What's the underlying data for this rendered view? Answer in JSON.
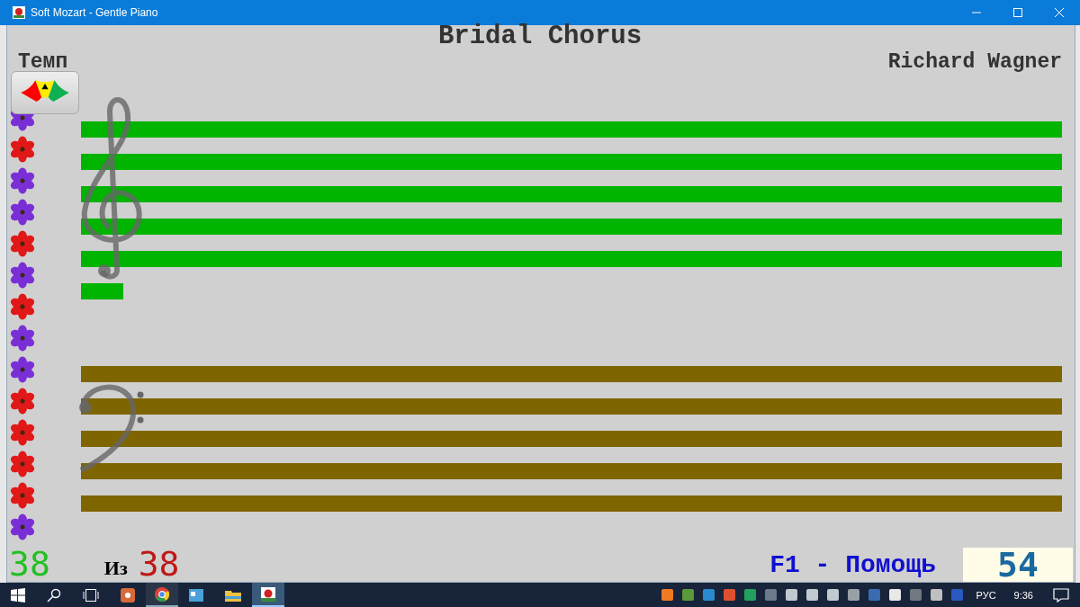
{
  "window": {
    "title": "Soft Mozart - Gentle Piano"
  },
  "piece": {
    "title": "Bridal Chorus",
    "composer": "Richard Wagner"
  },
  "tempo": {
    "label": "Темп",
    "level": 0.5
  },
  "flowers": [
    {
      "color": "#7a2fd6"
    },
    {
      "color": "#e01818"
    },
    {
      "color": "#7a2fd6"
    },
    {
      "color": "#7a2fd6"
    },
    {
      "color": "#e01818"
    },
    {
      "color": "#7a2fd6"
    },
    {
      "color": "#e01818"
    },
    {
      "color": "#7a2fd6"
    },
    {
      "color": "#7a2fd6"
    },
    {
      "color": "#e01818"
    },
    {
      "color": "#e01818"
    },
    {
      "color": "#e01818"
    },
    {
      "color": "#e01818"
    },
    {
      "color": "#7a2fd6"
    }
  ],
  "staves": [
    {
      "kind": "treble",
      "color": "#00b400",
      "ledger_below": true
    },
    {
      "kind": "bass",
      "color": "#7f6500",
      "ledger_below": false
    }
  ],
  "footer": {
    "progress": "38",
    "of_label": "Из",
    "total": "38",
    "help": "F1 - Помощь",
    "score": "54"
  },
  "taskbar": {
    "language": "РУС",
    "time": "9:36"
  }
}
